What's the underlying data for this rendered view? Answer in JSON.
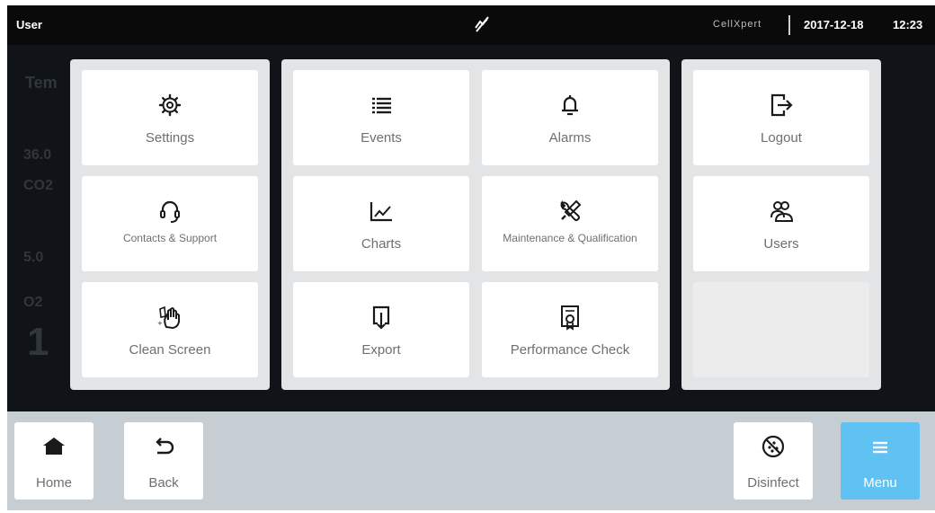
{
  "status_bar": {
    "user": "User",
    "brand": "CellXpert",
    "date": "2017-12-18",
    "time": "12:23",
    "connection_icon": "no-connection-icon"
  },
  "background_readouts": [
    "Tem",
    "36.0",
    "CO2",
    "5.0",
    "O2",
    "1"
  ],
  "menu": {
    "settings": {
      "label": "Settings",
      "icon": "gear-icon"
    },
    "contacts": {
      "label": "Contacts & Support",
      "icon": "headset-icon"
    },
    "clean_screen": {
      "label": "Clean Screen",
      "icon": "hand-wipe-icon"
    },
    "events": {
      "label": "Events",
      "icon": "list-icon"
    },
    "alarms": {
      "label": "Alarms",
      "icon": "bell-icon"
    },
    "charts": {
      "label": "Charts",
      "icon": "line-chart-icon"
    },
    "maintenance": {
      "label": "Maintenance & Qualification",
      "icon": "wrench-screwdriver-icon"
    },
    "export": {
      "label": "Export",
      "icon": "export-icon"
    },
    "performance": {
      "label": "Performance Check",
      "icon": "certificate-icon"
    },
    "logout": {
      "label": "Logout",
      "icon": "logout-icon"
    },
    "users": {
      "label": "Users",
      "icon": "users-icon"
    }
  },
  "nav": {
    "home": {
      "label": "Home",
      "icon": "home-icon"
    },
    "back": {
      "label": "Back",
      "icon": "back-arrow-icon"
    },
    "disinfect": {
      "label": "Disinfect",
      "icon": "disinfect-icon"
    },
    "menu": {
      "label": "Menu",
      "icon": "hamburger-icon"
    }
  },
  "colors": {
    "accent": "#5fc2f3",
    "status_bar": "#0a0a0a",
    "panel": "#e3e4e5",
    "nav_bar": "#c6cdd3",
    "tile_text": "#6f6f6f"
  }
}
